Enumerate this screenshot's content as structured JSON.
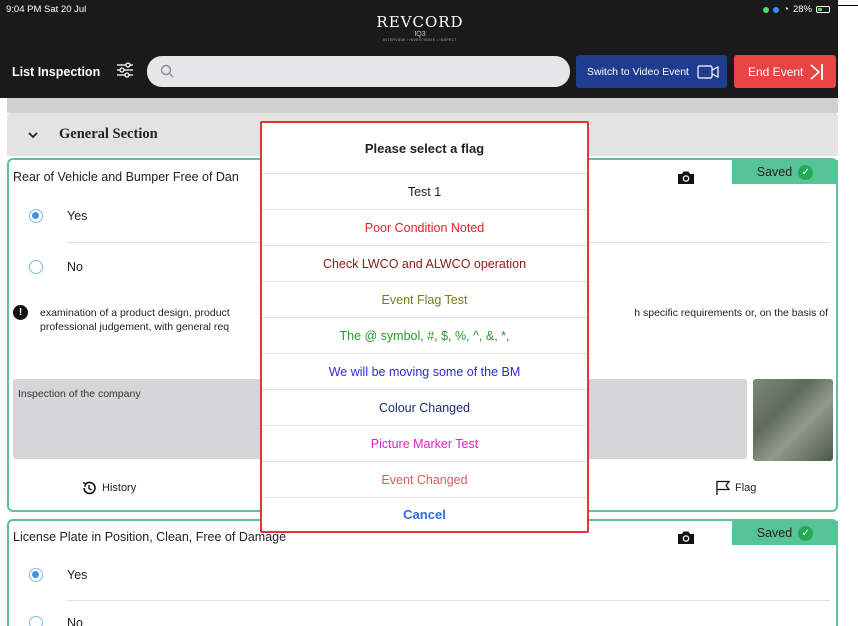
{
  "status_bar": {
    "time": "9:04 PM  Sat 20 Jul",
    "battery": "28%"
  },
  "brand": {
    "name": "REVCORD",
    "sub": "IQ3",
    "tagline": "INTERVIEW • INVESTIGATE • INSPECT"
  },
  "header": {
    "list_title": "List Inspection",
    "search": {
      "placeholder": "",
      "value": ""
    },
    "video_button": "Switch to Video Event",
    "end_button": "End Event"
  },
  "section": {
    "title": "General Section"
  },
  "card1": {
    "question": "Rear of Vehicle and Bumper Free of Dan",
    "saved_label": "Saved",
    "options": [
      "Yes",
      "No"
    ],
    "selected": "Yes",
    "info_line1_left": "examination of a product design, product",
    "info_line1_right": "h specific requirements or, on the basis of",
    "info_line2": "professional judgement, with general req",
    "notes": "Inspection of the company",
    "history_label": "History",
    "flag_label": "Flag"
  },
  "card2": {
    "question": "License Plate in Position, Clean, Free of Damage",
    "saved_label": "Saved",
    "options": [
      "Yes",
      "No"
    ],
    "selected": "Yes"
  },
  "modal": {
    "title": "Please select a flag",
    "options": [
      {
        "label": "Test 1",
        "color": "#222222"
      },
      {
        "label": "Poor Condition Noted",
        "color": "#e02424"
      },
      {
        "label": "Check LWCO and ALWCO operation",
        "color": "#8b1a1a"
      },
      {
        "label": "Event Flag Test",
        "color": "#7b7a1e"
      },
      {
        "label": "The @ symbol, #, $, %, ^, &, *,",
        "color": "#2a9a2a"
      },
      {
        "label": "We will be moving some of the BM",
        "color": "#2a2ad8"
      },
      {
        "label": "Colour Changed",
        "color": "#1c2a78"
      },
      {
        "label": "Picture Marker Test",
        "color": "#e020c8"
      },
      {
        "label": "Event Changed",
        "color": "#d9605a"
      }
    ],
    "cancel": "Cancel"
  },
  "colors": {
    "accent_green": "#57c497",
    "video_blue": "#1f3c8f",
    "end_red": "#e94345",
    "modal_border": "#e53434"
  }
}
